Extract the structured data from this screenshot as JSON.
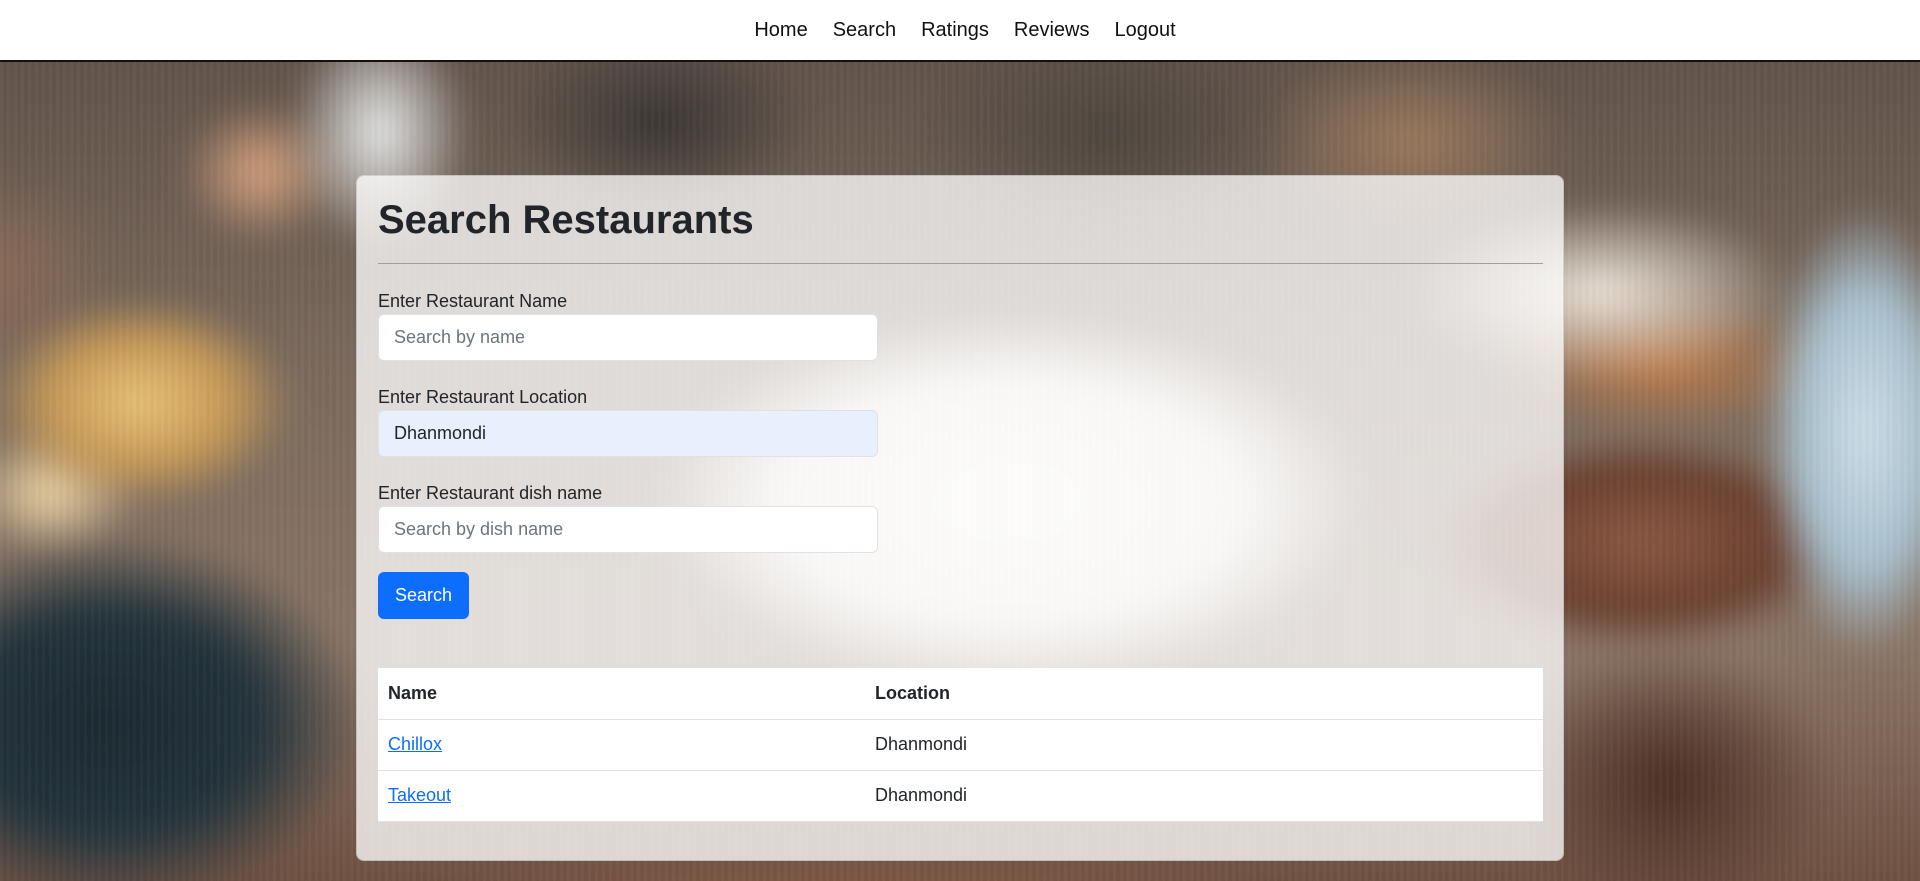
{
  "nav": {
    "items": [
      {
        "label": "Home"
      },
      {
        "label": "Search"
      },
      {
        "label": "Ratings"
      },
      {
        "label": "Reviews"
      },
      {
        "label": "Logout"
      }
    ]
  },
  "page": {
    "title": "Search Restaurants"
  },
  "form": {
    "name": {
      "label": "Enter Restaurant Name",
      "value": "",
      "placeholder": "Search by name"
    },
    "location": {
      "label": "Enter Restaurant Location",
      "value": "Dhanmondi",
      "placeholder": ""
    },
    "dish": {
      "label": "Enter Restaurant dish name",
      "value": "",
      "placeholder": "Search by dish name"
    },
    "submit_label": "Search"
  },
  "results": {
    "columns": [
      "Name",
      "Location"
    ],
    "rows": [
      {
        "name": "Chillox",
        "location": "Dhanmondi"
      },
      {
        "name": "Takeout",
        "location": "Dhanmondi"
      }
    ]
  },
  "colors": {
    "primary": "#0d6efd",
    "autofill_bg": "#e8f0fe"
  }
}
